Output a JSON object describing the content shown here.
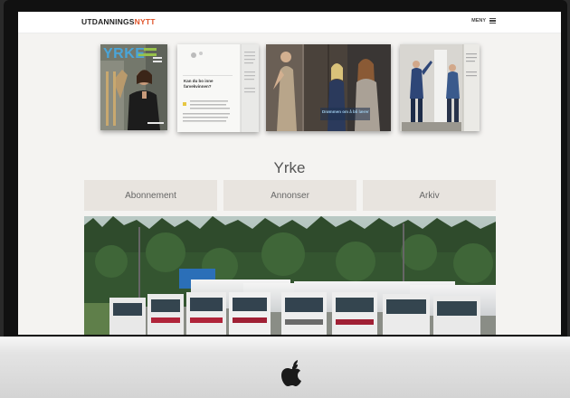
{
  "header": {
    "logo_part1": "UTDANNINGS",
    "logo_part2": "NYTT",
    "menu_label": "MENY"
  },
  "magazines": [
    {
      "cover_title": "YRKE"
    },
    {
      "spread_heading": "Kan du bo inne farvekvinnen?"
    },
    {
      "spread_caption": "Drømmen om å bli lærer"
    },
    {}
  ],
  "page": {
    "title": "Yrke"
  },
  "nav": {
    "items": [
      "Abonnement",
      "Annonser",
      "Arkiv"
    ]
  },
  "colors": {
    "logo_accent": "#e0542a",
    "nav_bg": "#e8e4df",
    "screen_bg": "#f4f3f1"
  },
  "icons": [
    "hamburger-menu-icon",
    "apple-logo-icon"
  ]
}
